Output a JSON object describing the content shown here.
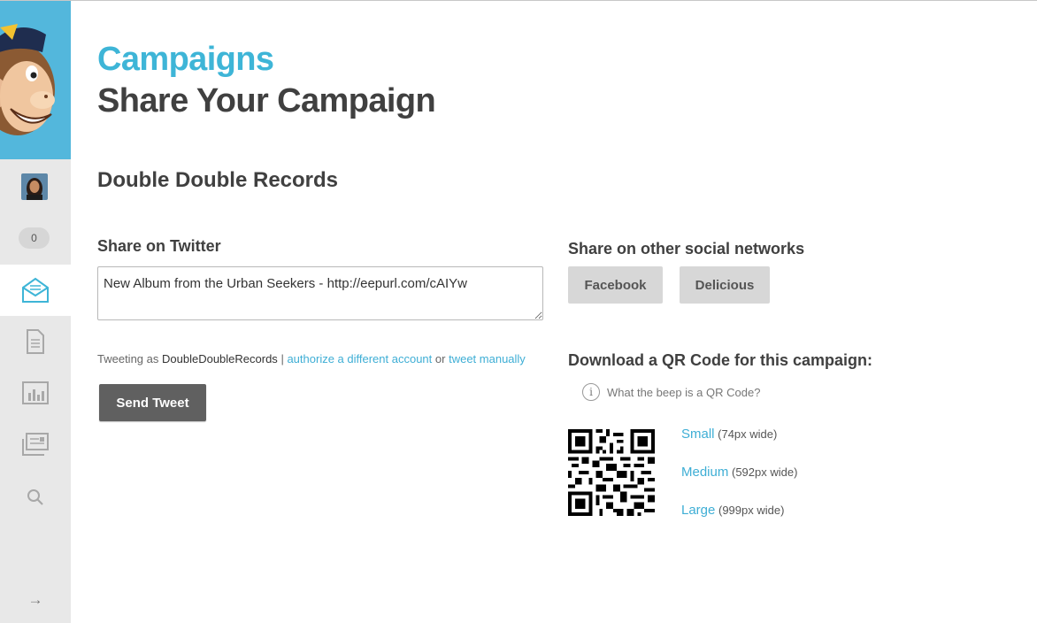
{
  "sidebar": {
    "notification_count": "0",
    "nav_items": [
      {
        "name": "campaigns",
        "icon": "envelope-icon",
        "active": true
      },
      {
        "name": "templates",
        "icon": "document-icon",
        "active": false
      },
      {
        "name": "reports",
        "icon": "bar-chart-icon",
        "active": false
      },
      {
        "name": "lists",
        "icon": "lists-icon",
        "active": false
      },
      {
        "name": "search",
        "icon": "search-icon",
        "active": false
      }
    ],
    "expand_glyph": "→"
  },
  "header": {
    "section": "Campaigns",
    "title": "Share Your Campaign"
  },
  "campaign": {
    "name": "Double Double Records"
  },
  "twitter": {
    "heading": "Share on Twitter",
    "tweet_text": "New Album from the Urban Seekers - http://eepurl.com/cAIYw",
    "tweeting_as_label": "Tweeting as",
    "account": "DoubleDoubleRecords",
    "separator": "|",
    "authorize_link": "authorize a different account",
    "or_text": "or",
    "manual_link": "tweet manually",
    "send_label": "Send Tweet"
  },
  "social": {
    "heading": "Share on other social networks",
    "facebook_label": "Facebook",
    "delicious_label": "Delicious"
  },
  "qr": {
    "heading": "Download a QR Code for this campaign:",
    "help_text": "What the beep is a QR Code?",
    "sizes": [
      {
        "label": "Small",
        "note": "(74px wide)"
      },
      {
        "label": "Medium",
        "note": "(592px wide)"
      },
      {
        "label": "Large",
        "note": "(999px wide)"
      }
    ]
  },
  "colors": {
    "brand_blue": "#53b7dc",
    "link_blue": "#3eaed5",
    "title_blue": "#3eb5d7",
    "dark_button": "#606060",
    "light_button": "#d7d7d7"
  }
}
